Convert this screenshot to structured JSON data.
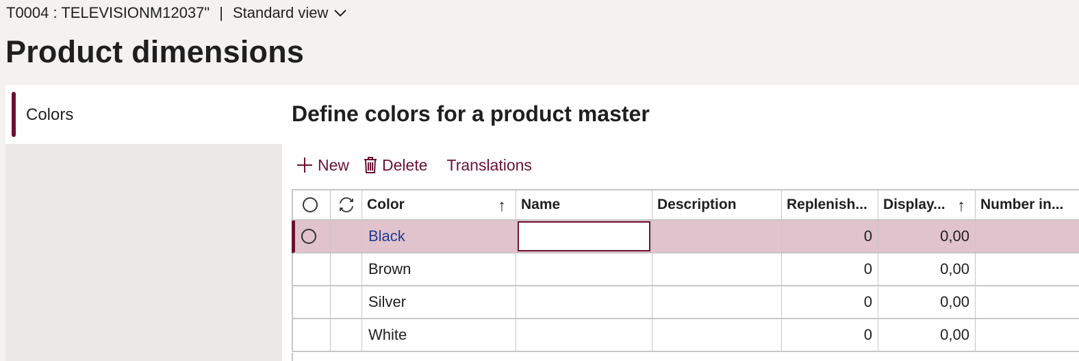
{
  "header": {
    "record": "T0004 : TELEVISIONM12037\"",
    "separator": "|",
    "view_label": "Standard view"
  },
  "page_title": "Product dimensions",
  "nav": {
    "items": [
      {
        "label": "Colors",
        "selected": true
      }
    ]
  },
  "section_title": "Define colors for a product master",
  "toolbar": {
    "new_label": "New",
    "delete_label": "Delete",
    "translations_label": "Translations"
  },
  "grid": {
    "columns": [
      "Color",
      "Name",
      "Description",
      "Replenish...",
      "Display...",
      "Number in..."
    ],
    "sorted_columns": [
      "Color",
      "Display..."
    ],
    "rows": [
      {
        "color": "Black",
        "name": "",
        "description": "",
        "replenish": "0",
        "display": "0,00",
        "number": "",
        "selected": true
      },
      {
        "color": "Brown",
        "name": "",
        "description": "",
        "replenish": "0",
        "display": "0,00",
        "number": ""
      },
      {
        "color": "Silver",
        "name": "",
        "description": "",
        "replenish": "0",
        "display": "0,00",
        "number": ""
      },
      {
        "color": "White",
        "name": "",
        "description": "",
        "replenish": "0",
        "display": "0,00",
        "number": ""
      }
    ]
  },
  "colors": {
    "accent": "#6b1030",
    "selected_row": "#e0c3cc",
    "link": "#1f3b8f"
  }
}
